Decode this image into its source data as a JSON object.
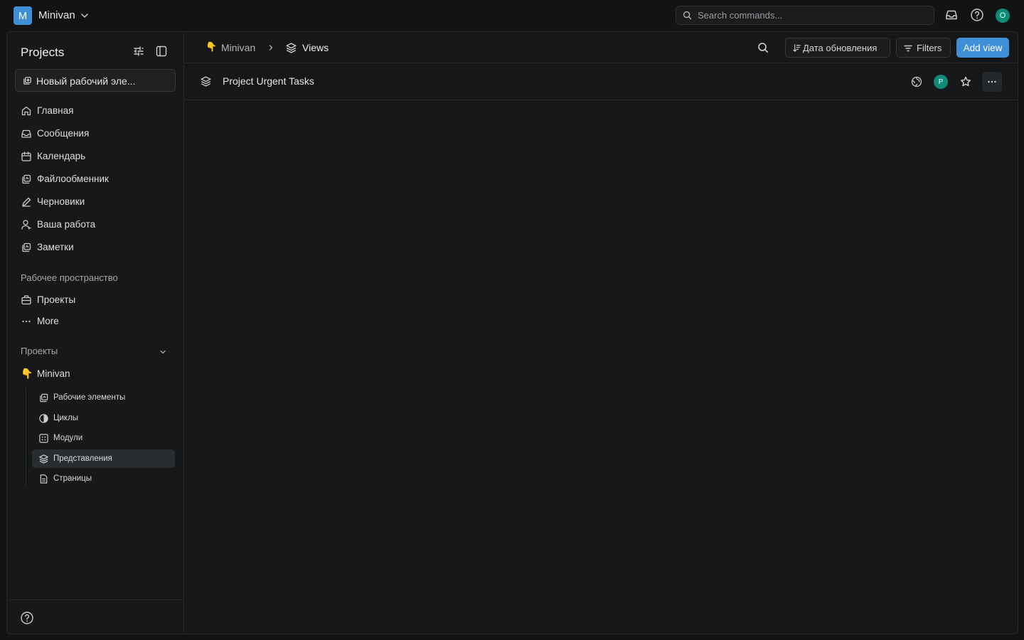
{
  "topbar": {
    "workspace_initial": "M",
    "workspace_name": "Minivan",
    "search_placeholder": "Search commands...",
    "user_initial": "O",
    "icons": [
      "chevron-down-icon",
      "search-icon",
      "inbox-icon",
      "help-icon"
    ]
  },
  "sidebar": {
    "title": "Projects",
    "new_item_label": "Новый рабочий эле...",
    "nav": [
      {
        "label": "Главная",
        "icon": "home-icon"
      },
      {
        "label": "Сообщения",
        "icon": "inbox-icon"
      },
      {
        "label": "Календарь",
        "icon": "calendar-icon"
      },
      {
        "label": "Файлообменник",
        "icon": "stack-icon"
      },
      {
        "label": "Черновики",
        "icon": "pen-icon"
      },
      {
        "label": "Ваша работа",
        "icon": "user-icon"
      },
      {
        "label": "Заметки",
        "icon": "stack-icon"
      }
    ],
    "workspace_section": "Рабочее пространство",
    "workspace_items": [
      {
        "label": "Проекты",
        "icon": "briefcase-icon"
      },
      {
        "label": "More",
        "icon": "more-icon"
      }
    ],
    "projects_section": "Проекты",
    "project": {
      "emoji": "👇",
      "name": "Minivan"
    },
    "project_children": [
      {
        "label": "Рабочие элементы",
        "icon": "stack-icon",
        "active": false
      },
      {
        "label": "Циклы",
        "icon": "contrast-icon",
        "active": false
      },
      {
        "label": "Модули",
        "icon": "grid-icon",
        "active": false
      },
      {
        "label": "Представления",
        "icon": "layers-icon",
        "active": true
      },
      {
        "label": "Страницы",
        "icon": "file-icon",
        "active": false
      }
    ]
  },
  "header": {
    "breadcrumb_emoji": "👇",
    "breadcrumb_project": "Minivan",
    "breadcrumb_current": "Views",
    "sort_label": "Дата обновления",
    "filters_label": "Filters",
    "add_view_label": "Add view"
  },
  "views": [
    {
      "title": "Project Urgent Tasks",
      "owner_initial": "P"
    }
  ],
  "colors": {
    "accent": "#3f8fd8",
    "avatar": "#0f8a76",
    "background": "#121313"
  }
}
